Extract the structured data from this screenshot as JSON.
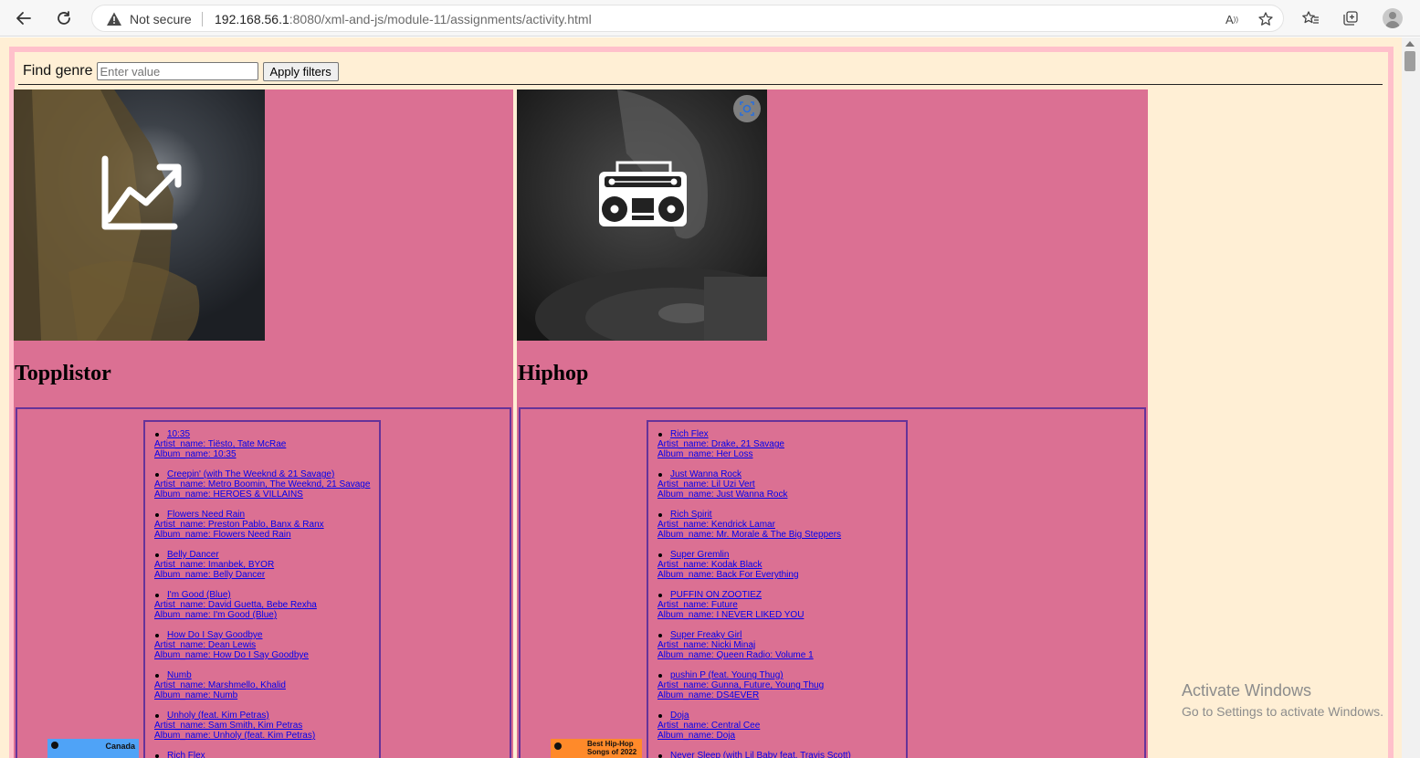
{
  "browser": {
    "security_label": "Not secure",
    "url_host": "192.168.56.1",
    "url_rest": ":8080/xml-and-js/module-11/assignments/activity.html"
  },
  "filter": {
    "label": "Find genre",
    "placeholder": "Enter value",
    "button": "Apply filters"
  },
  "genres": [
    {
      "title": "Topplistor",
      "icon": "trending-chart-icon",
      "playlist_thumb": "Canada",
      "tracks": [
        {
          "name": "10:35",
          "artist": "Artist_name: Tiësto, Tate McRae",
          "album": "Album_name: 10:35"
        },
        {
          "name": "Creepin' (with The Weeknd & 21 Savage)",
          "artist": "Artist_name: Metro Boomin, The Weeknd, 21 Savage",
          "album": "Album_name: HEROES & VILLAINS"
        },
        {
          "name": "Flowers Need Rain",
          "artist": "Artist_name: Preston Pablo, Banx & Ranx",
          "album": "Album_name: Flowers Need Rain"
        },
        {
          "name": "Belly Dancer",
          "artist": "Artist_name: Imanbek, BYOR",
          "album": "Album_name: Belly Dancer"
        },
        {
          "name": "I'm Good (Blue)",
          "artist": "Artist_name: David Guetta, Bebe Rexha",
          "album": "Album_name: I'm Good (Blue)"
        },
        {
          "name": "How Do I Say Goodbye",
          "artist": "Artist_name: Dean Lewis",
          "album": "Album_name: How Do I Say Goodbye"
        },
        {
          "name": "Numb",
          "artist": "Artist_name: Marshmello, Khalid",
          "album": "Album_name: Numb"
        },
        {
          "name": "Unholy (feat. Kim Petras)",
          "artist": "Artist_name: Sam Smith, Kim Petras",
          "album": "Album_name: Unholy (feat. Kim Petras)"
        },
        {
          "name": "Rich Flex",
          "artist": "",
          "album": ""
        }
      ]
    },
    {
      "title": "Hiphop",
      "icon": "boombox-icon",
      "playlist_thumb": "Best Hip-Hop Songs of 2022",
      "tracks": [
        {
          "name": "Rich Flex",
          "artist": "Artist_name: Drake, 21 Savage",
          "album": "Album_name: Her Loss"
        },
        {
          "name": "Just Wanna Rock",
          "artist": "Artist_name: Lil Uzi Vert",
          "album": "Album_name: Just Wanna Rock"
        },
        {
          "name": "Rich Spirit",
          "artist": "Artist_name: Kendrick Lamar",
          "album": "Album_name: Mr. Morale & The Big Steppers"
        },
        {
          "name": "Super Gremlin",
          "artist": "Artist_name: Kodak Black",
          "album": "Album_name: Back For Everything"
        },
        {
          "name": "PUFFIN ON ZOOTIEZ",
          "artist": "Artist_name: Future",
          "album": "Album_name: I NEVER LIKED YOU"
        },
        {
          "name": "Super Freaky Girl",
          "artist": "Artist_name: Nicki Minaj",
          "album": "Album_name: Queen Radio: Volume 1"
        },
        {
          "name": "pushin P (feat. Young Thug)",
          "artist": "Artist_name: Gunna, Future, Young Thug",
          "album": "Album_name: DS4EVER"
        },
        {
          "name": "Doja",
          "artist": "Artist_name: Central Cee",
          "album": "Album_name: Doja"
        },
        {
          "name": "Never Sleep (with Lil Baby feat. Travis Scott)",
          "artist": "",
          "album": ""
        }
      ]
    }
  ],
  "watermark": {
    "line1": "Activate Windows",
    "line2": "Go to Settings to activate Windows."
  },
  "colors": {
    "page_bg": "#ffefd5",
    "frame": "#ffc0cb",
    "card": "#db7093",
    "list_border": "#663399",
    "link": "#0000ee"
  }
}
